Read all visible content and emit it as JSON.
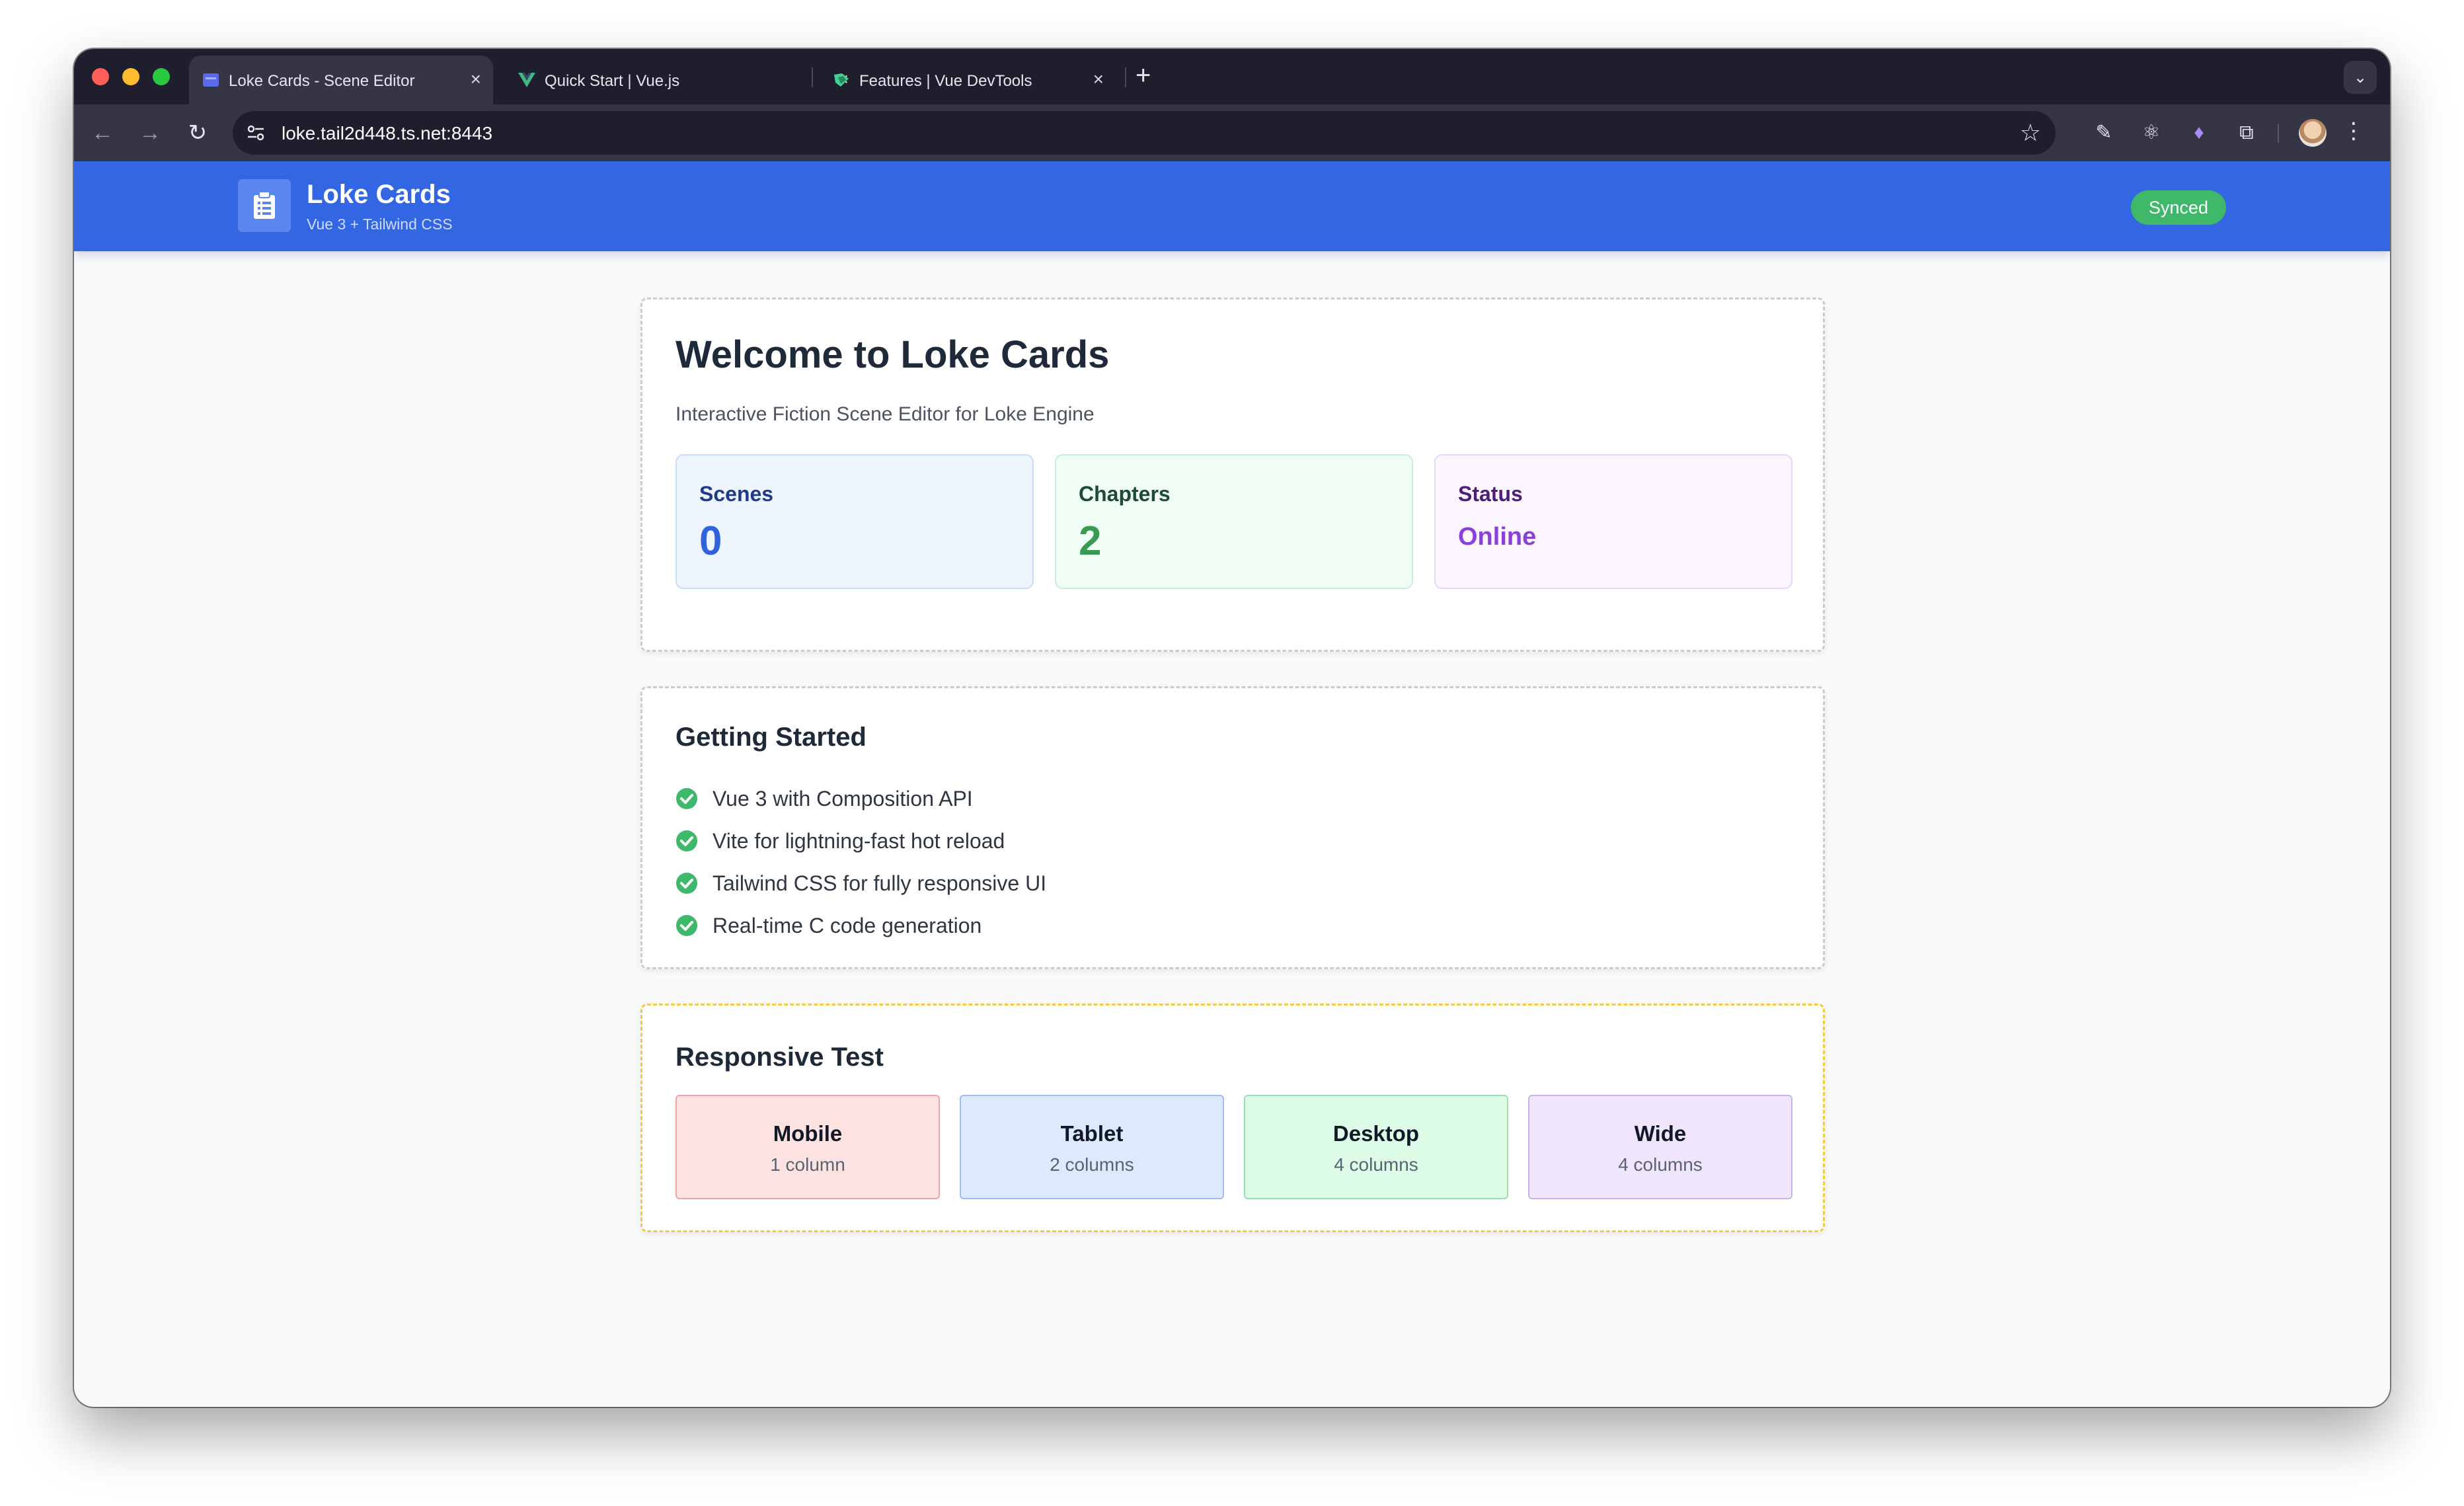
{
  "browser": {
    "tabs": [
      {
        "title": "Loke Cards - Scene Editor",
        "icon": "clipboard-favicon",
        "active": true
      },
      {
        "title": "Quick Start | Vue.js",
        "icon": "vue-favicon",
        "active": false
      },
      {
        "title": "Features | Vue DevTools",
        "icon": "devtools-favicon",
        "active": false
      }
    ],
    "close_glyph": "×",
    "new_tab_glyph": "+",
    "url": "loke.tail2d448.ts.net:8443"
  },
  "header": {
    "title": "Loke Cards",
    "subtitle": "Vue 3 + Tailwind CSS",
    "status_badge": "Synced",
    "colors": {
      "header_bg": "#3366e3",
      "badge_bg": "#3fb86a"
    }
  },
  "welcome": {
    "title": "Welcome to Loke Cards",
    "lead": "Interactive Fiction Scene Editor for Loke Engine",
    "stats": [
      {
        "label": "Scenes",
        "value": "0",
        "color": "#2f62dd"
      },
      {
        "label": "Chapters",
        "value": "2",
        "color": "#3a9a54"
      },
      {
        "label": "Status",
        "value": "Online",
        "color": "#8a3fd8"
      }
    ]
  },
  "getting_started": {
    "title": "Getting Started",
    "items": [
      "Vue 3 with Composition API",
      "Vite for lightning-fast hot reload",
      "Tailwind CSS for fully responsive UI",
      "Real-time C code generation"
    ]
  },
  "responsive_test": {
    "title": "Responsive Test",
    "tiles": [
      {
        "title": "Mobile",
        "subtitle": "1 column"
      },
      {
        "title": "Tablet",
        "subtitle": "2 columns"
      },
      {
        "title": "Desktop",
        "subtitle": "4 columns"
      },
      {
        "title": "Wide",
        "subtitle": "4 columns"
      }
    ]
  }
}
